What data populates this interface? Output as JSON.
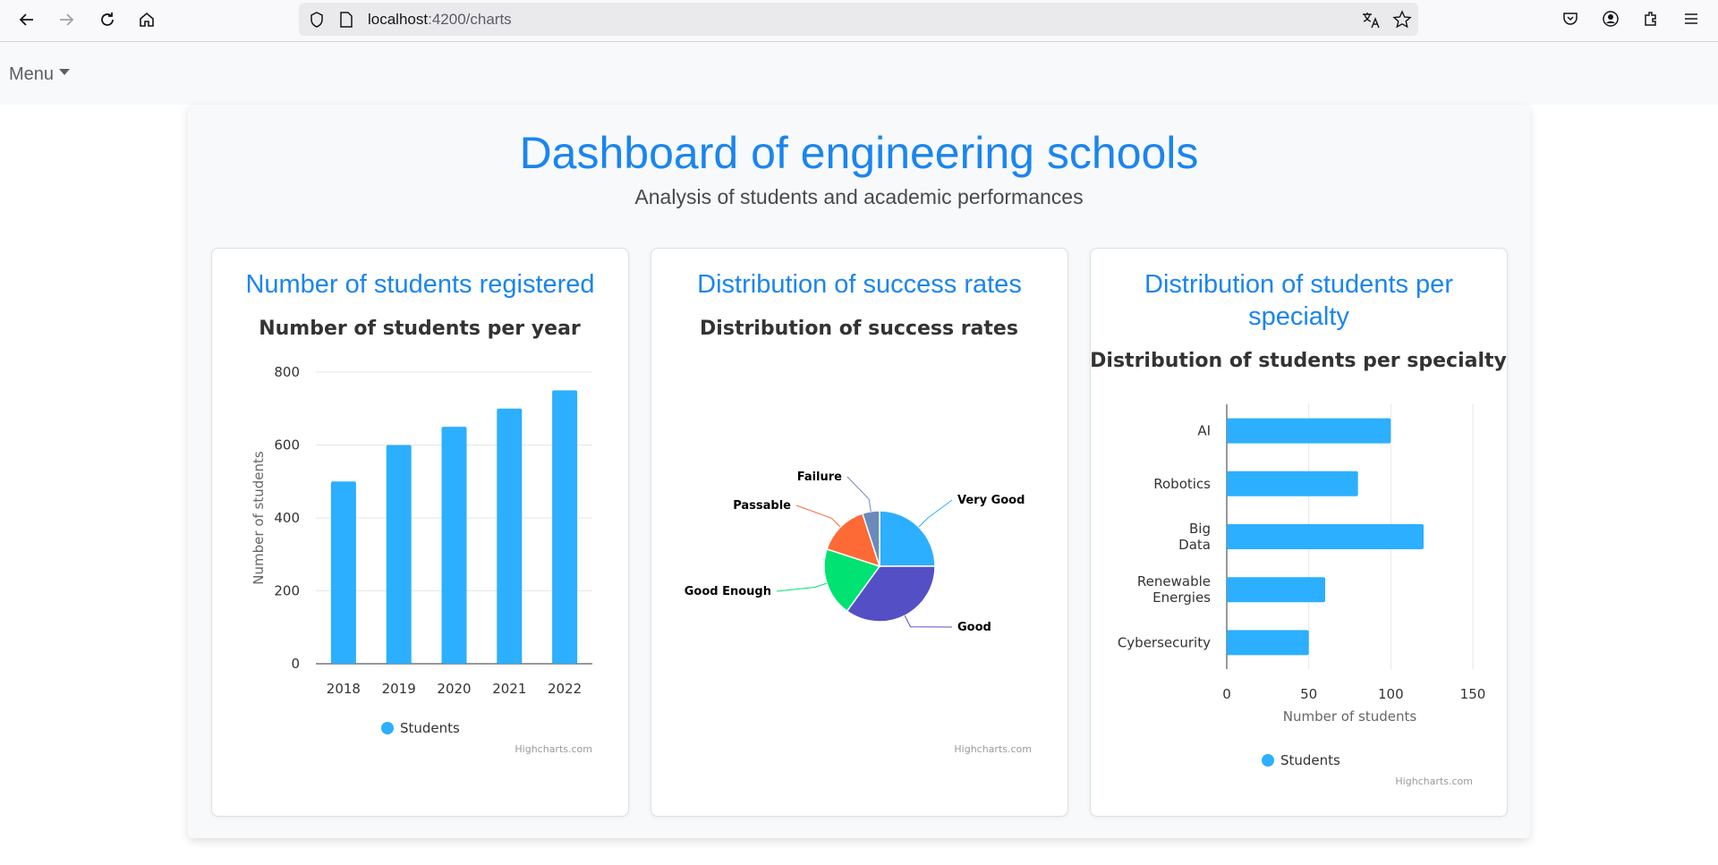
{
  "browser": {
    "url_host": "localhost",
    "url_path": ":4200/charts"
  },
  "menu": {
    "label": "Menu"
  },
  "page": {
    "title": "Dashboard of engineering schools",
    "subtitle": "Analysis of students and academic performances"
  },
  "cards": [
    {
      "title": "Number of students registered"
    },
    {
      "title": "Distribution of success rates"
    },
    {
      "title": "Distribution of students per specialty"
    }
  ],
  "chart_data": [
    {
      "type": "bar",
      "title": "Number of students per year",
      "categories": [
        "2018",
        "2019",
        "2020",
        "2021",
        "2022"
      ],
      "series": [
        {
          "name": "Students",
          "values": [
            500,
            600,
            650,
            700,
            750
          ],
          "color": "#2caffe"
        }
      ],
      "ylabel": "Number of students",
      "ylim": [
        0,
        800
      ],
      "yticks": [
        0,
        200,
        400,
        600,
        800
      ],
      "grid": true,
      "legend": "bottom-center",
      "credit": "Highcharts.com"
    },
    {
      "type": "pie",
      "title": "Distribution of success rates",
      "slices": [
        {
          "label": "Very Good",
          "value": 25,
          "color": "#2caffe"
        },
        {
          "label": "Good",
          "value": 35,
          "color": "#544fc5"
        },
        {
          "label": "Good Enough",
          "value": 20,
          "color": "#00e272"
        },
        {
          "label": "Passable",
          "value": 15,
          "color": "#fe6a35"
        },
        {
          "label": "Failure",
          "value": 5,
          "color": "#6b8abc"
        }
      ],
      "credit": "Highcharts.com"
    },
    {
      "type": "bar",
      "orientation": "horizontal",
      "title": "Distribution of students per specialty",
      "categories": [
        "AI",
        "Robotics",
        "Big Data",
        "Renewable Energies",
        "Cybersecurity"
      ],
      "series": [
        {
          "name": "Students",
          "values": [
            100,
            80,
            120,
            60,
            50
          ],
          "color": "#2caffe"
        }
      ],
      "xlabel": "Number of students",
      "xlim": [
        0,
        150
      ],
      "xticks": [
        0,
        50,
        100,
        150
      ],
      "grid": true,
      "legend": "bottom-center",
      "credit": "Highcharts.com"
    }
  ]
}
